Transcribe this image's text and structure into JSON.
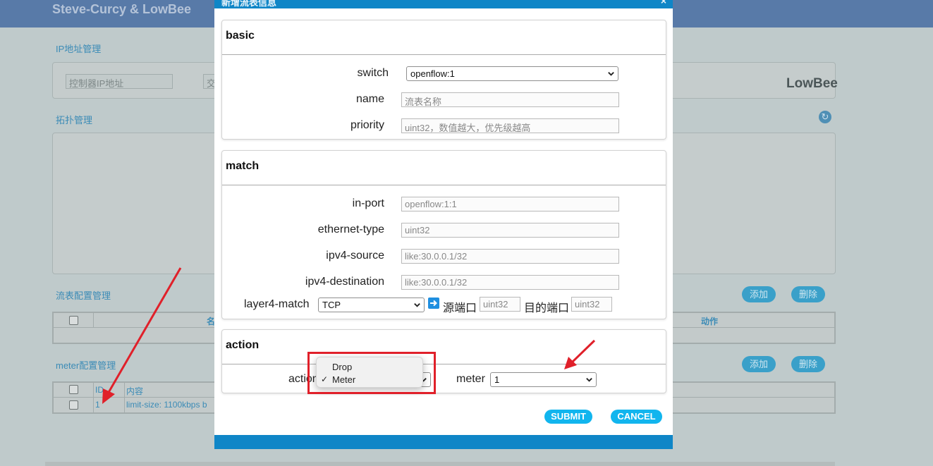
{
  "app": {
    "title": "Steve-Curcy & LowBee",
    "brand": "LowBee"
  },
  "background": {
    "ip_section": {
      "title": "IP地址管理",
      "controller_placeholder": "控制器IP地址",
      "switch_placeholder_fragment": "交"
    },
    "topology_section": {
      "title": "拓扑管理"
    },
    "flow_section": {
      "title": "流表配置管理",
      "add_label": "添加",
      "delete_label": "删除",
      "columns": [
        "名",
        "动作"
      ]
    },
    "meter_section": {
      "title": "meter配置管理",
      "add_label": "添加",
      "delete_label": "删除",
      "columns": [
        "ID",
        "内容"
      ],
      "rows": [
        {
          "id": "1",
          "content": "limit-size: 1100kbps b"
        }
      ]
    }
  },
  "modal": {
    "title": "新增流表信息",
    "close": "×",
    "basic": {
      "title": "basic",
      "switch_label": "switch",
      "switch_value": "openflow:1",
      "name_label": "name",
      "name_placeholder": "流表名称",
      "priority_label": "priority",
      "priority_placeholder": "uint32，数值越大，优先级越高"
    },
    "match": {
      "title": "match",
      "in_port_label": "in-port",
      "in_port_placeholder": "openflow:1:1",
      "ethernet_type_label": "ethernet-type",
      "ethernet_type_placeholder": "uint32",
      "ipv4_source_label": "ipv4-source",
      "ipv4_source_placeholder": "like:30.0.0.1/32",
      "ipv4_destination_label": "ipv4-destination",
      "ipv4_destination_placeholder": "like:30.0.0.1/32",
      "layer4_label": "layer4-match",
      "layer4_value": "TCP",
      "src_port_label": "源端口",
      "src_port_placeholder": "uint32",
      "dst_port_label": "目的端口",
      "dst_port_placeholder": "uint32"
    },
    "action": {
      "title": "action",
      "action_label": "action",
      "action_options": [
        "Drop",
        "Meter"
      ],
      "action_selected": "Meter",
      "checkmark": "✓",
      "meter_label": "meter",
      "meter_value": "1"
    },
    "submit_label": "SUBMIT",
    "cancel_label": "CANCEL"
  },
  "colors": {
    "header_bar": "#587aa8",
    "modal_accent": "#0f86c7",
    "button": "#11b5ee",
    "annotation": "#e0202a"
  }
}
